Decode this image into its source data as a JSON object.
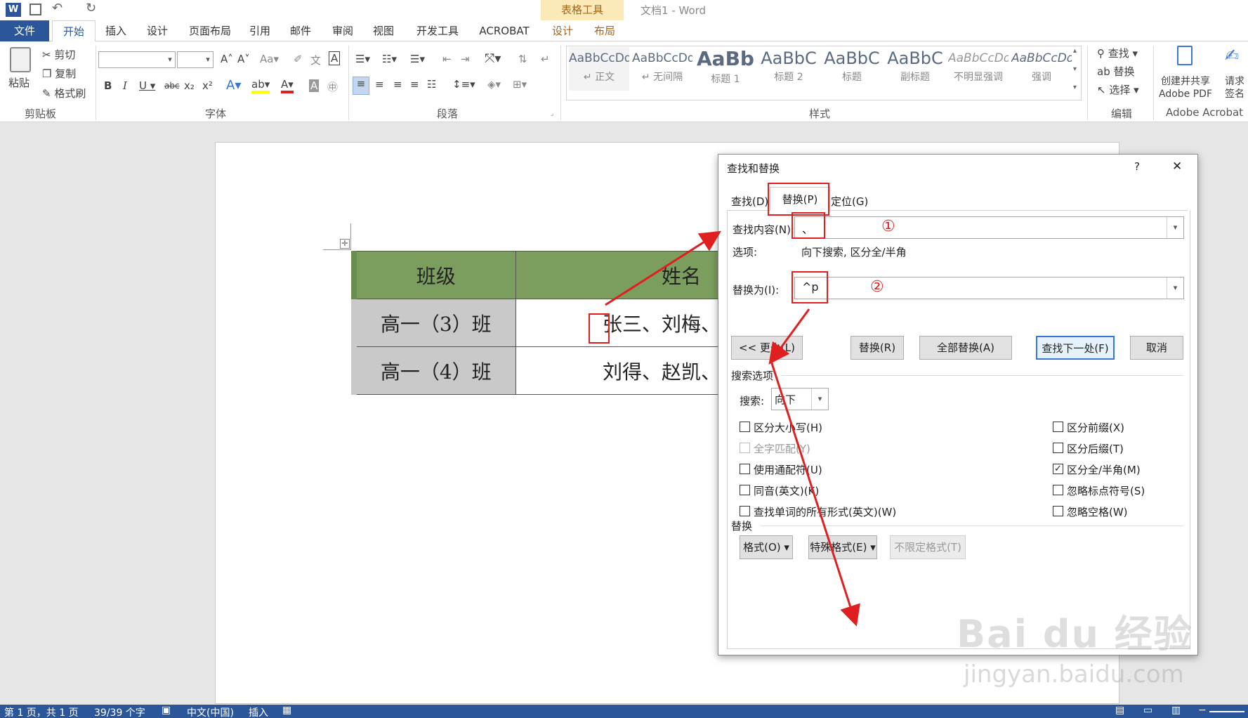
{
  "window": {
    "title": "文档1 - Word",
    "context_tab_group": "表格工具",
    "context_tabs": [
      "设计",
      "布局"
    ]
  },
  "tabs": [
    "文件",
    "开始",
    "插入",
    "设计",
    "页面布局",
    "引用",
    "邮件",
    "审阅",
    "视图",
    "开发工具",
    "ACROBAT"
  ],
  "ribbon": {
    "clipboard": {
      "paste": "粘贴",
      "cut": "剪切",
      "copy": "复制",
      "format_painter": "格式刷",
      "label": "剪贴板"
    },
    "font": {
      "label": "字体"
    },
    "paragraph": {
      "label": "段落"
    },
    "styles": {
      "label": "样式",
      "items": [
        {
          "sample": "AaBbCcDd",
          "name": "↵ 正文"
        },
        {
          "sample": "AaBbCcDd",
          "name": "↵ 无间隔"
        },
        {
          "sample": "AaBb",
          "name": "标题 1"
        },
        {
          "sample": "AaBbC",
          "name": "标题 2"
        },
        {
          "sample": "AaBbC",
          "name": "标题"
        },
        {
          "sample": "AaBbC",
          "name": "副标题"
        },
        {
          "sample": "AaBbCcDd",
          "name": "不明显强调"
        },
        {
          "sample": "AaBbCcDd",
          "name": "强调"
        }
      ]
    },
    "editing": {
      "find": "查找",
      "replace": "替换",
      "select": "选择",
      "label": "编辑"
    },
    "acrobat": {
      "create_pdf": "创建并共享",
      "create_pdf2": "Adobe PDF",
      "sign": "请求",
      "sign2": "签名",
      "label": "Adobe Acrobat"
    }
  },
  "document_table": {
    "header": [
      "班级",
      "姓名"
    ],
    "rows": [
      [
        "高一（3）班",
        "张三、刘梅、王丹"
      ],
      [
        "高一（4）班",
        "刘得、赵凯、李丹"
      ]
    ]
  },
  "dialog": {
    "title": "查找和替换",
    "help": "?",
    "close": "✕",
    "tabs": [
      "查找(D)",
      "替换(P)",
      "定位(G)"
    ],
    "find_label": "查找内容(N):",
    "find_value": "、",
    "options_label": "选项:",
    "options_value": "向下搜索, 区分全/半角",
    "replace_label": "替换为(I):",
    "replace_value": "^p",
    "annotation_1": "①",
    "annotation_2": "②",
    "buttons": {
      "less": "<< 更少(L)",
      "replace": "替换(R)",
      "replace_all": "全部替换(A)",
      "find_next": "查找下一处(F)",
      "cancel": "取消"
    },
    "search_options_title": "搜索选项",
    "search_label": "搜索:",
    "search_value": "向下",
    "checkboxes_left": [
      {
        "label": "区分大小写(H)",
        "checked": false
      },
      {
        "label": "全字匹配(Y)",
        "checked": false,
        "disabled": true
      },
      {
        "label": "使用通配符(U)",
        "checked": false
      },
      {
        "label": "同音(英文)(K)",
        "checked": false
      },
      {
        "label": "查找单词的所有形式(英文)(W)",
        "checked": false
      }
    ],
    "checkboxes_right": [
      {
        "label": "区分前缀(X)",
        "checked": false
      },
      {
        "label": "区分后缀(T)",
        "checked": false
      },
      {
        "label": "区分全/半角(M)",
        "checked": true
      },
      {
        "label": "忽略标点符号(S)",
        "checked": false
      },
      {
        "label": "忽略空格(W)",
        "checked": false
      }
    ],
    "replace_section": "替换",
    "format_button": "格式(O) ▾",
    "special_button": "特殊格式(E) ▾",
    "no_format_button": "不限定格式(T)"
  },
  "statusbar": {
    "page": "第 1 页，共 1 页",
    "words": "39/39 个字",
    "language": "中文(中国)",
    "mode": "插入"
  },
  "watermark": {
    "text": "Bai du 经验",
    "url": "jingyan.baidu.com"
  }
}
